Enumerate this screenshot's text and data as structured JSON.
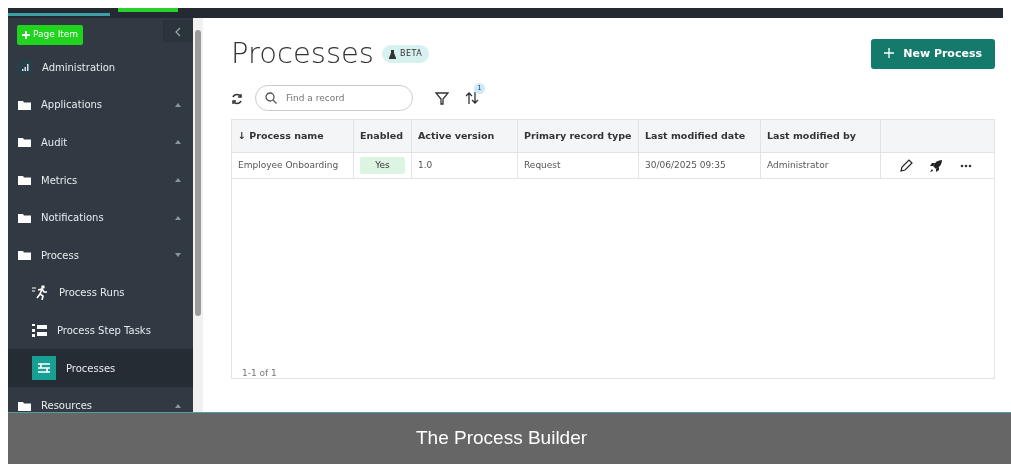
{
  "sidebar": {
    "add_button": "Page Item",
    "items": [
      {
        "label": "Administration",
        "kind": "admin",
        "selected": false
      },
      {
        "label": "Applications",
        "kind": "folder",
        "expanded": false,
        "selected": false
      },
      {
        "label": "Audit",
        "kind": "folder",
        "expanded": false,
        "selected": false
      },
      {
        "label": "Metrics",
        "kind": "folder",
        "expanded": false,
        "selected": false
      },
      {
        "label": "Notifications",
        "kind": "folder",
        "expanded": false,
        "selected": false
      },
      {
        "label": "Process",
        "kind": "folder",
        "expanded": true,
        "selected": false
      },
      {
        "label": "Process Runs",
        "kind": "runs",
        "selected": false
      },
      {
        "label": "Process Step Tasks",
        "kind": "tasks",
        "selected": false
      },
      {
        "label": "Processes",
        "kind": "processes",
        "selected": true
      },
      {
        "label": "Resources",
        "kind": "folder",
        "expanded": false,
        "selected": false
      }
    ]
  },
  "page": {
    "title": "Processes",
    "badge": "BETA",
    "new_button": "New Process"
  },
  "toolbar": {
    "search": {
      "placeholder": "Find a record"
    },
    "sort_count": "1"
  },
  "table": {
    "columns": [
      {
        "label": "↓ Process name"
      },
      {
        "label": "Enabled"
      },
      {
        "label": "Active version"
      },
      {
        "label": "Primary record type"
      },
      {
        "label": "Last modified date"
      },
      {
        "label": "Last modified by"
      }
    ],
    "rows": [
      {
        "cells": [
          "Employee Onboarding",
          "Yes",
          "1.0",
          "Request",
          "30/06/2025 09:35",
          "Administrator"
        ],
        "enabled": true
      }
    ],
    "pager": "1-1 of 1"
  },
  "caption": "The Process Builder"
}
